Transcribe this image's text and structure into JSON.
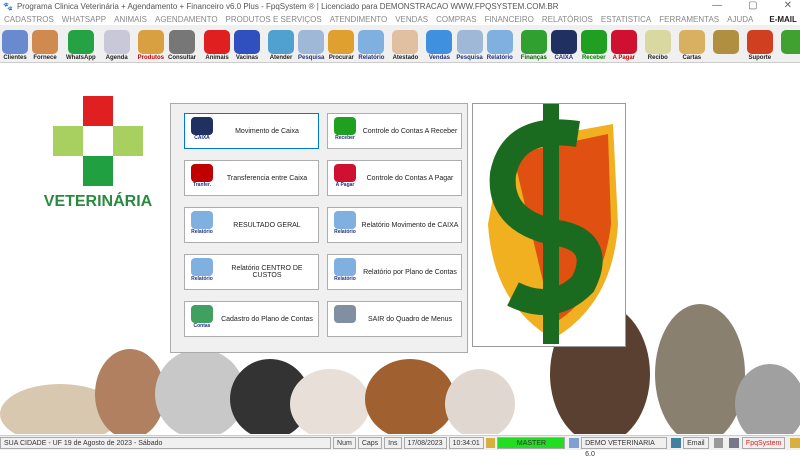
{
  "window": {
    "title": "Programa Clinica Veterinária + Agendamento + Financeiro v6.0 Plus - FpqSystem ® | Licenciado para  DEMONSTRACAO WWW.FPQSYSTEM.COM.BR",
    "minimize": "—",
    "maximize": "▢",
    "close": "✕"
  },
  "menu": [
    "CADASTROS",
    "WHATSAPP",
    "ANIMAIS",
    "AGENDAMENTO",
    "PRODUTOS E SERVIÇOS",
    "ATENDIMENTO",
    "VENDAS",
    "COMPRAS",
    "FINANCEIRO",
    "RELATÓRIOS",
    "ESTATISTICA",
    "FERRAMENTAS",
    "AJUDA",
    "E-MAIL"
  ],
  "toolbar": [
    {
      "label": "Clientes",
      "color": "#6a8ad0"
    },
    {
      "label": "Fornece",
      "color": "#d08a50"
    },
    {
      "sep": true
    },
    {
      "label": "WhatsApp",
      "color": "#25a244"
    },
    {
      "sep": true
    },
    {
      "label": "Agenda",
      "color": "#c8c8d8"
    },
    {
      "sep": true
    },
    {
      "label": "Produtos",
      "color": "#d8a040",
      "labelColor": "#c00000"
    },
    {
      "label": "Consultar",
      "color": "#777"
    },
    {
      "sep": true
    },
    {
      "label": "Animais",
      "color": "#e02020"
    },
    {
      "label": "Vacinas",
      "color": "#3050c0"
    },
    {
      "sep": true
    },
    {
      "label": "Atender",
      "color": "#50a0d0"
    },
    {
      "label": "Pesquisa",
      "color": "#a0b8d8",
      "labelColor": "#203080"
    },
    {
      "label": "Procurar",
      "color": "#e0a030"
    },
    {
      "label": "Relatório",
      "color": "#80b0e0",
      "labelColor": "#203080"
    },
    {
      "sep": true
    },
    {
      "label": "Atestado",
      "color": "#e0c0a0"
    },
    {
      "sep": true
    },
    {
      "label": "Vendas",
      "color": "#4090e0",
      "labelColor": "#203080"
    },
    {
      "label": "Pesquisa",
      "color": "#a0b8d8",
      "labelColor": "#203080"
    },
    {
      "label": "Relatório",
      "color": "#80b0e0",
      "labelColor": "#203080"
    },
    {
      "sep": true
    },
    {
      "label": "Finanças",
      "color": "#30a030",
      "labelColor": "#006000"
    },
    {
      "label": "CAIXA",
      "color": "#203060",
      "labelColor": "#203080"
    },
    {
      "label": "Receber",
      "color": "#20a020",
      "labelColor": "#008000"
    },
    {
      "label": "A Pagar",
      "color": "#d01030",
      "labelColor": "#c00000"
    },
    {
      "sep": true
    },
    {
      "label": "Recibo",
      "color": "#d8d8a0"
    },
    {
      "sep": true
    },
    {
      "label": "Cartas",
      "color": "#d8b060"
    },
    {
      "sep": true
    },
    {
      "label": "",
      "color": "#b09040"
    },
    {
      "sep": true
    },
    {
      "label": "Suporte",
      "color": "#d04020"
    },
    {
      "sep": true
    },
    {
      "label": "",
      "color": "#40a030"
    }
  ],
  "logo": {
    "text": "VETERINÁRIA"
  },
  "panel": {
    "buttons": [
      {
        "label": "Movimento de Caixa",
        "icon": "cash-book-icon",
        "iconText": "CAIXA",
        "iconColor": "#203060",
        "selected": true
      },
      {
        "label": "Controle do Contas A Receber",
        "icon": "receive-dollar-icon",
        "iconText": "Receber",
        "iconColor": "#20a020"
      },
      {
        "label": "Transferencia entre Caixa",
        "icon": "transfer-icon",
        "iconText": "Tranfer.",
        "iconColor": "#c00000"
      },
      {
        "label": "Controle do Contas A Pagar",
        "icon": "pay-dollar-icon",
        "iconText": "A Pagar",
        "iconColor": "#d01030"
      },
      {
        "label": "RESULTADO GERAL",
        "icon": "report-icon",
        "iconText": "Relatório",
        "iconColor": "#80b0e0"
      },
      {
        "label": "Relatório Movimento de CAIXA",
        "icon": "report-icon",
        "iconText": "Relatório",
        "iconColor": "#80b0e0"
      },
      {
        "label": "Relatório CENTRO DE CUSTOS",
        "icon": "report-icon",
        "iconText": "Relatório",
        "iconColor": "#80b0e0"
      },
      {
        "label": "Relatório por Plano de Contas",
        "icon": "report-icon",
        "iconText": "Relatório",
        "iconColor": "#80b0e0"
      },
      {
        "label": "Cadastro do Plano de Contas",
        "icon": "accounts-calendar-icon",
        "iconText": "Contas",
        "iconColor": "#40a060"
      },
      {
        "label": "SAIR do Quadro de Menus",
        "icon": "exit-icon",
        "iconText": "",
        "iconColor": "#8090a0"
      }
    ]
  },
  "status": {
    "location": "SUA CIDADE - UF 19 de Agosto de 2023 - Sábado",
    "num": "Num",
    "caps": "Caps",
    "ins": "Ins",
    "date": "17/08/2023",
    "time": "10:34:01",
    "user": "MASTER",
    "company": "DEMO VETERINARIA 6.0",
    "email": "Email",
    "brand": "FpqSystem"
  }
}
